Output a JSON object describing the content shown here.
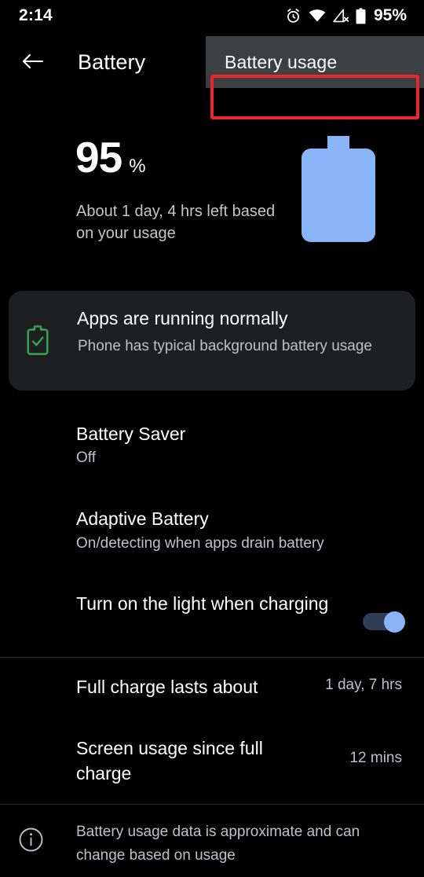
{
  "status_bar": {
    "clock": "2:14",
    "battery_percent_label": "95%",
    "icons": [
      "alarm-icon",
      "wifi-icon",
      "mobile-signal-off-icon",
      "battery-icon"
    ]
  },
  "app_bar": {
    "back_icon": "back-arrow-icon",
    "title": "Battery",
    "usage_chip_label": "Battery usage",
    "highlight_color": "#e8262b",
    "chip_background": "#3c4043"
  },
  "summary": {
    "percent_value": "95",
    "percent_sign": "%",
    "estimate_text": "About 1 day, 4 hrs left based on your usage",
    "battery_graphic_color": "#8ab4f8"
  },
  "status_card": {
    "icon": "battery-check-icon",
    "icon_color": "#34a853",
    "title": "Apps are running normally",
    "subtitle": "Phone has typical background battery usage"
  },
  "settings_rows": [
    {
      "name": "battery-saver",
      "title": "Battery Saver",
      "subtitle": "Off"
    },
    {
      "name": "adaptive-battery",
      "title": "Adaptive Battery",
      "subtitle": "On/detecting when apps drain battery"
    },
    {
      "name": "charging-light",
      "title": "Turn on the light when charging",
      "toggle_state": "on"
    }
  ],
  "info_rows": [
    {
      "name": "full-charge-lasts-about",
      "title": "Full charge lasts about",
      "value": "1 day, 7 hrs"
    },
    {
      "name": "screen-usage-since-full-charge",
      "title": "Screen usage since full charge",
      "value": "12 mins"
    }
  ],
  "footer": {
    "icon": "info-icon",
    "text": "Battery usage data is approximate and can change based on usage"
  }
}
